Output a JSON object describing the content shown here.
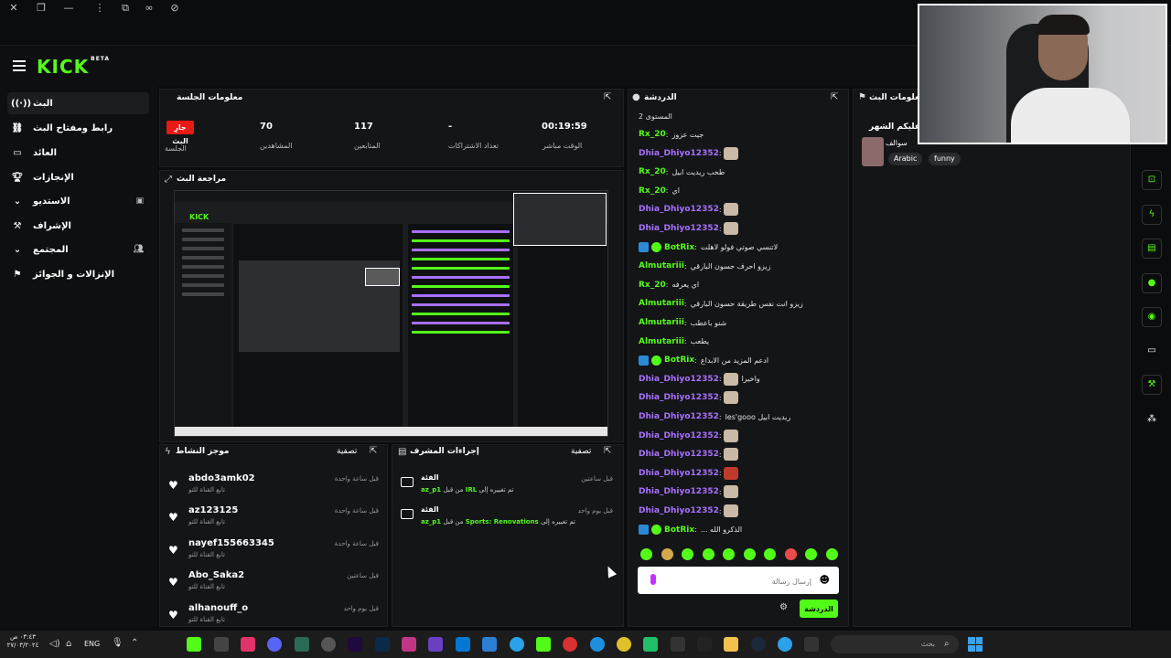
{
  "app": {
    "logo": "KICK",
    "logo_sup": "BETA"
  },
  "sidebar": {
    "items": [
      {
        "label": "البث",
        "icon": "broadcast-icon"
      },
      {
        "label": "رابط ومفتاح البث",
        "icon": "link-icon"
      },
      {
        "label": "العائد",
        "icon": "money-icon"
      },
      {
        "label": "الإنجازات",
        "icon": "trophy-icon"
      },
      {
        "label": "الاستديو",
        "icon": "chevron-down-icon"
      },
      {
        "label": "الإشراف",
        "icon": "wrench-icon"
      },
      {
        "label": "المجتمع",
        "icon": "chevron-down-icon"
      },
      {
        "label": "الإنزالات و الجوائز",
        "icon": "gift-icon"
      }
    ]
  },
  "session": {
    "title": "معلومات الجلسة",
    "live_badge": "جارِ البث",
    "stats": [
      {
        "value": "",
        "label": "الجلسة"
      },
      {
        "value": "70",
        "label": "المشاهدين"
      },
      {
        "value": "117",
        "label": "المتابعين"
      },
      {
        "value": "-",
        "label": "تعداد الاشتراكات"
      },
      {
        "value": "00:19:59",
        "label": "الوقت مباشر"
      }
    ]
  },
  "preview": {
    "title": "مراجعة البث",
    "inner_logo": "KICK"
  },
  "activity": {
    "title": "موجز النشاط",
    "filter": "تصفية",
    "items": [
      {
        "user": "abdo3amk02",
        "action": "تابع القناة للتو",
        "time": "قبل ساعة واحدة"
      },
      {
        "user": "az123125",
        "action": "تابع القناة للتو",
        "time": "قبل ساعة واحدة"
      },
      {
        "user": "nayef155663345",
        "action": "تابع القناة للتو",
        "time": "قبل ساعة واحدة"
      },
      {
        "user": "Abo_Saka2",
        "action": "تابع القناة للتو",
        "time": "قبل ساعتين"
      },
      {
        "user": "alhanouff_o",
        "action": "تابع القناة للتو",
        "time": "قبل يوم واحد"
      }
    ]
  },
  "mod_actions": {
    "title": "إجراءات المشرف",
    "filter": "تصفية",
    "items": [
      {
        "title": "الفئة",
        "desc_prefix": "تم تغييره إلى",
        "category": "IRL",
        "by": "من قبل",
        "user": "az_p1",
        "time": "قبل ساعتين"
      },
      {
        "title": "الفئة",
        "desc_prefix": "تم تغييره إلى",
        "category": "Sports: Renovations",
        "by": "من قبل",
        "user": "az_p1",
        "time": "قبل يوم واحد"
      }
    ]
  },
  "chat": {
    "title": "الدردشة",
    "level": "المستوى 2",
    "messages": [
      {
        "user": "Rx_20",
        "color": "#53fc18",
        "text": "جيت عزوز",
        "badges": false,
        "emote": false
      },
      {
        "user": "Dhia_Dhiyo12352",
        "color": "#a970ff",
        "text": "",
        "badges": false,
        "emote": true
      },
      {
        "user": "Rx_20",
        "color": "#53fc18",
        "text": "طحب ريديت ابيل",
        "badges": false,
        "emote": false
      },
      {
        "user": "Rx_20",
        "color": "#53fc18",
        "text": "اي",
        "badges": false,
        "emote": false
      },
      {
        "user": "Dhia_Dhiyo12352",
        "color": "#a970ff",
        "text": "",
        "badges": false,
        "emote": true
      },
      {
        "user": "Dhia_Dhiyo12352",
        "color": "#a970ff",
        "text": "",
        "badges": false,
        "emote": true
      },
      {
        "user": "BotRix",
        "color": "#53fc18",
        "text": "لاتنسي صوتي فولو لاهلت",
        "badges": true,
        "emote": false
      },
      {
        "user": "Almutariii",
        "color": "#53fc18",
        "text": "زيزو احرف حسون البارقي",
        "badges": false,
        "emote": false
      },
      {
        "user": "Rx_20",
        "color": "#53fc18",
        "text": "اي يعرفه",
        "badges": false,
        "emote": false
      },
      {
        "user": "Almutariii",
        "color": "#53fc18",
        "text": "زيزو انت نفس طريقة حسون البارقي",
        "badges": false,
        "emote": false
      },
      {
        "user": "Almutariii",
        "color": "#53fc18",
        "text": "شنو باعطب",
        "badges": false,
        "emote": false
      },
      {
        "user": "Almutariii",
        "color": "#53fc18",
        "text": "يطعب",
        "badges": false,
        "emote": false
      },
      {
        "user": "BotRix",
        "color": "#53fc18",
        "text": "ادعم المزيد من الابداع",
        "badges": true,
        "emote": false
      },
      {
        "user": "Dhia_Dhiyo12352",
        "color": "#a970ff",
        "text": "واخيرا",
        "badges": false,
        "emote": true
      },
      {
        "user": "Dhia_Dhiyo12352",
        "color": "#a970ff",
        "text": "",
        "badges": false,
        "emote": true
      },
      {
        "user": "Dhia_Dhiyo12352",
        "color": "#a970ff",
        "text": "les'gooo ريديت ابيل",
        "badges": false,
        "emote": false
      },
      {
        "user": "Dhia_Dhiyo12352",
        "color": "#a970ff",
        "text": "",
        "badges": false,
        "emote": true
      },
      {
        "user": "Dhia_Dhiyo12352",
        "color": "#a970ff",
        "text": "",
        "badges": false,
        "emote": true
      },
      {
        "user": "Dhia_Dhiyo12352",
        "color": "#a970ff",
        "text": "",
        "badges": false,
        "emote": true
      },
      {
        "user": "Dhia_Dhiyo12352",
        "color": "#a970ff",
        "text": "",
        "badges": false,
        "emote": true
      },
      {
        "user": "Dhia_Dhiyo12352",
        "color": "#a970ff",
        "text": "",
        "badges": false,
        "emote": true
      },
      {
        "user": "BotRix",
        "color": "#53fc18",
        "text": "... الذكرو الله",
        "badges": true,
        "emote": false
      }
    ],
    "input_placeholder": "إرسال رسالة",
    "send_label": "الدردشة"
  },
  "stream_info": {
    "title": "معلومات البث",
    "stream_title": "مبارك عليكم الشهر",
    "subtitle": "سوالف",
    "tags": [
      "Arabic",
      "funny"
    ]
  },
  "taskbar": {
    "clock_time": "٠٣:٤٣ ص",
    "clock_date": "٢٧/٠٣/٢٠٢٤",
    "lang": "ENG",
    "search_placeholder": "بحث"
  },
  "colors": {
    "accent": "#53fc18",
    "live": "#e91916",
    "purple_user": "#a970ff"
  }
}
